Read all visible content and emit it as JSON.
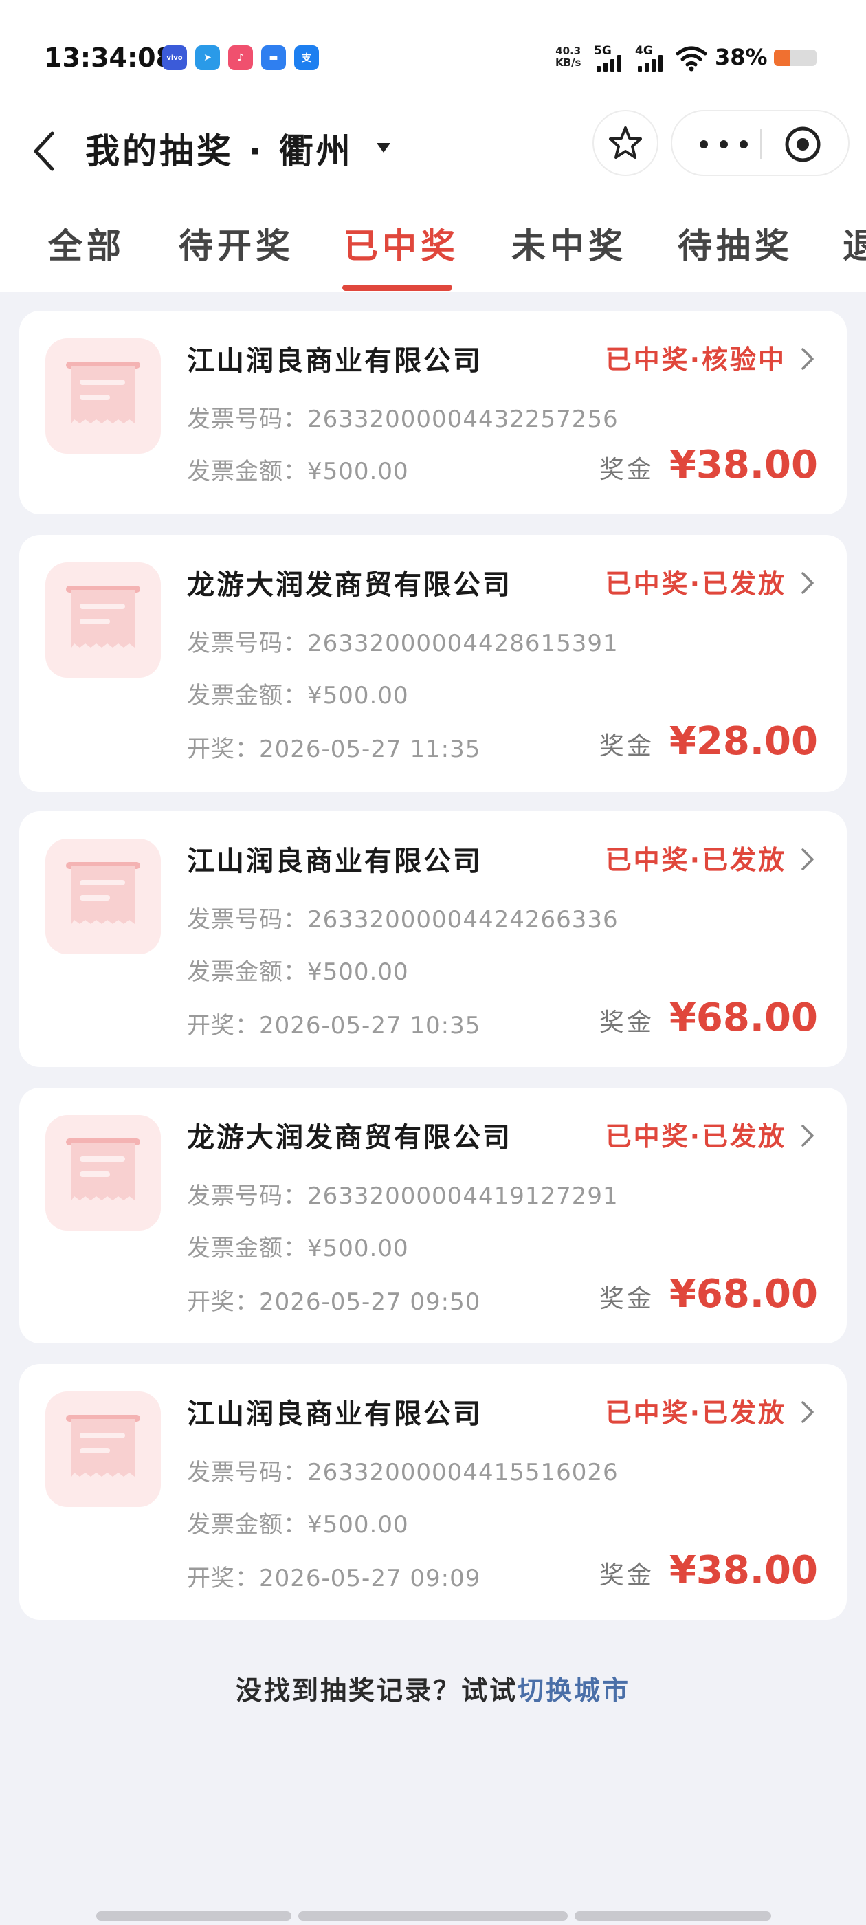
{
  "status_bar": {
    "time": "13:34:08",
    "apps": [
      {
        "name": "vivo-app",
        "text": "vivo",
        "color": "#3b5bd9"
      },
      {
        "name": "send-app",
        "text": "➤",
        "color": "#2a9ae8"
      },
      {
        "name": "douyin-app",
        "text": "♪",
        "color": "#f0506e"
      },
      {
        "name": "message-app",
        "text": "▬",
        "color": "#2f7ff0"
      },
      {
        "name": "alipay-app",
        "text": "支",
        "color": "#1d7ff0"
      }
    ],
    "net_speed_value": "40.3",
    "net_speed_unit": "KB/s",
    "signal_1_label": "5G",
    "signal_2_label": "4G",
    "battery": "38%",
    "battery_level": 0.38
  },
  "nav": {
    "title": "我的抽奖 · 衢州"
  },
  "tabs": [
    "全部",
    "待开奖",
    "已中奖",
    "未中奖",
    "待抽奖",
    "退"
  ],
  "active_tab": "已中奖",
  "cards": [
    {
      "company": "江山润良商业有限公司",
      "status": "已中奖·核验中",
      "invoice_no": "发票号码：26332000004432257256",
      "invoice_amount": "发票金额：¥500.00",
      "draw_time": "",
      "prize_label": "奖金",
      "prize": "¥38.00"
    },
    {
      "company": "龙游大润发商贸有限公司",
      "status": "已中奖·已发放",
      "invoice_no": "发票号码：26332000004428615391",
      "invoice_amount": "发票金额：¥500.00",
      "draw_time": "开奖：2026-05-27 11:35",
      "prize_label": "奖金",
      "prize": "¥28.00"
    },
    {
      "company": "江山润良商业有限公司",
      "status": "已中奖·已发放",
      "invoice_no": "发票号码：26332000004424266336",
      "invoice_amount": "发票金额：¥500.00",
      "draw_time": "开奖：2026-05-27 10:35",
      "prize_label": "奖金",
      "prize": "¥68.00"
    },
    {
      "company": "龙游大润发商贸有限公司",
      "status": "已中奖·已发放",
      "invoice_no": "发票号码：26332000004419127291",
      "invoice_amount": "发票金额：¥500.00",
      "draw_time": "开奖：2026-05-27 09:50",
      "prize_label": "奖金",
      "prize": "¥68.00"
    },
    {
      "company": "江山润良商业有限公司",
      "status": "已中奖·已发放",
      "invoice_no": "发票号码：26332000004415516026",
      "invoice_amount": "发票金额：¥500.00",
      "draw_time": "开奖：2026-05-27 09:09",
      "prize_label": "奖金",
      "prize": "¥38.00"
    }
  ],
  "footer": {
    "tip": "没找到抽奖记录？试试",
    "link": "切换城市"
  },
  "colors": {
    "accent": "#e0473c",
    "link": "#4a6fa8"
  }
}
